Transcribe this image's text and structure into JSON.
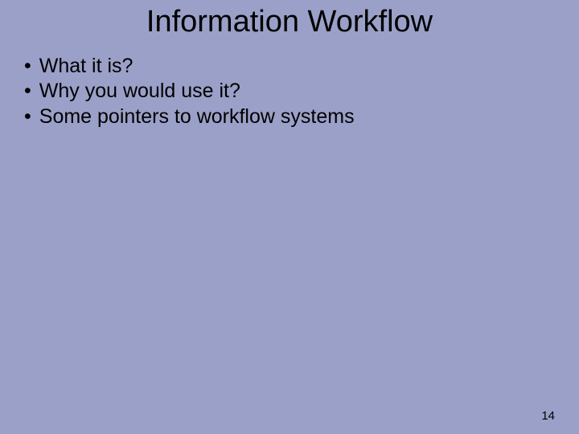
{
  "slide": {
    "title": "Information Workflow",
    "bullets": [
      "What it is?",
      "Why you would use it?",
      "Some pointers to workflow systems"
    ],
    "page_number": "14"
  }
}
